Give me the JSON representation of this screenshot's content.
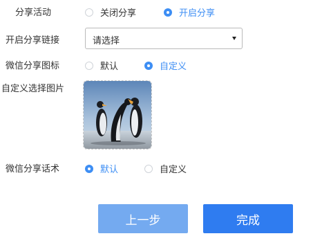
{
  "share_activity": {
    "label": "分享活动",
    "options": [
      {
        "label": "关闭分享",
        "checked": false
      },
      {
        "label": "开启分享",
        "checked": true
      }
    ]
  },
  "share_link": {
    "label": "开启分享链接",
    "select_value": "请选择"
  },
  "wechat_icon": {
    "label": "微信分享图标",
    "options": [
      {
        "label": "默认",
        "checked": false
      },
      {
        "label": "自定义",
        "checked": true
      }
    ]
  },
  "custom_image": {
    "label": "自定义选择图片",
    "image": "penguins-photo"
  },
  "wechat_text": {
    "label": "微信分享话术",
    "options": [
      {
        "label": "默认",
        "checked": true
      },
      {
        "label": "自定义",
        "checked": false
      }
    ]
  },
  "buttons": {
    "prev": "上一步",
    "done": "完成"
  },
  "colors": {
    "accent": "#3d8ef4",
    "prev_button": "#74aaf0",
    "done_button": "#2f7cf0"
  }
}
